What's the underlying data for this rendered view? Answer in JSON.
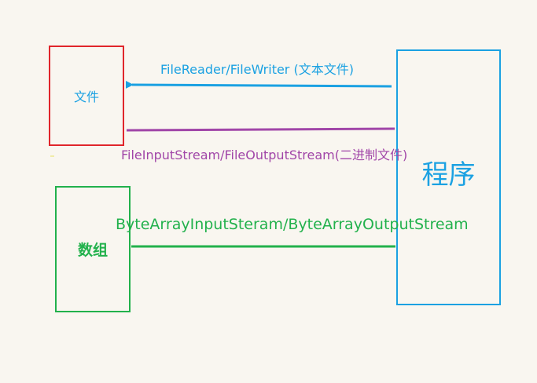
{
  "colors": {
    "background": "#f9f6f0",
    "file_box": "#e0252b",
    "program_box": "#1ba1e2",
    "array_box": "#22b14c",
    "text_stream_arrow": "#1ba1e2",
    "byte_stream_line": "#a146a8",
    "array_stream_line": "#22b14c"
  },
  "nodes": {
    "file": {
      "label": "文件"
    },
    "array": {
      "label": "数组"
    },
    "program": {
      "label": "程序"
    }
  },
  "edges": {
    "text_stream": {
      "label": "FileReader/FileWriter (文本文件)"
    },
    "byte_stream": {
      "label": "FileInputStream/FileOutputStream(二进制文件)"
    },
    "array_stream": {
      "label": "ByteArrayInputSteram/ByteArrayOutputStream"
    }
  }
}
